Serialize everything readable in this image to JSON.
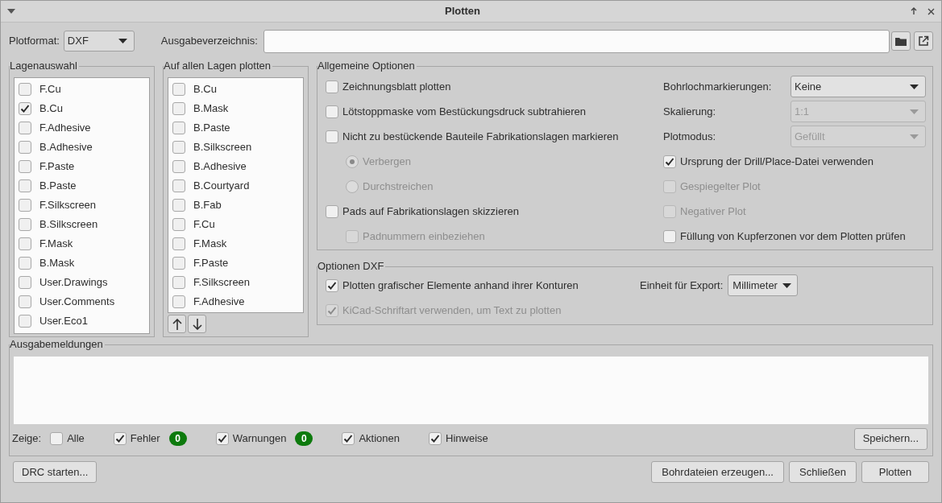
{
  "window": {
    "title": "Plotten"
  },
  "plot_format": {
    "label": "Plotformat:",
    "value": "DXF"
  },
  "output_dir": {
    "label": "Ausgabeverzeichnis:"
  },
  "layer_selection": {
    "title": "Lagenauswahl",
    "items": [
      {
        "label": "F.Cu",
        "checked": false
      },
      {
        "label": "B.Cu",
        "checked": true
      },
      {
        "label": "F.Adhesive",
        "checked": false
      },
      {
        "label": "B.Adhesive",
        "checked": false
      },
      {
        "label": "F.Paste",
        "checked": false
      },
      {
        "label": "B.Paste",
        "checked": false
      },
      {
        "label": "F.Silkscreen",
        "checked": false
      },
      {
        "label": "B.Silkscreen",
        "checked": false
      },
      {
        "label": "F.Mask",
        "checked": false
      },
      {
        "label": "B.Mask",
        "checked": false
      },
      {
        "label": "User.Drawings",
        "checked": false
      },
      {
        "label": "User.Comments",
        "checked": false
      },
      {
        "label": "User.Eco1",
        "checked": false
      }
    ]
  },
  "plot_on_all_layers": {
    "title": "Auf allen Lagen plotten",
    "items": [
      {
        "label": "B.Cu",
        "checked": false
      },
      {
        "label": "B.Mask",
        "checked": false
      },
      {
        "label": "B.Paste",
        "checked": false
      },
      {
        "label": "B.Silkscreen",
        "checked": false
      },
      {
        "label": "B.Adhesive",
        "checked": false
      },
      {
        "label": "B.Courtyard",
        "checked": false
      },
      {
        "label": "B.Fab",
        "checked": false
      },
      {
        "label": "F.Cu",
        "checked": false
      },
      {
        "label": "F.Mask",
        "checked": false
      },
      {
        "label": "F.Paste",
        "checked": false
      },
      {
        "label": "F.Silkscreen",
        "checked": false
      },
      {
        "label": "F.Adhesive",
        "checked": false
      }
    ]
  },
  "general_options": {
    "title": "Allgemeine Optionen",
    "left": [
      {
        "kind": "checkbox",
        "label": "Zeichnungsblatt plotten",
        "checked": false,
        "disabled": false
      },
      {
        "kind": "checkbox",
        "label": "Lötstoppmaske vom Bestückungsdruck subtrahieren",
        "checked": false,
        "disabled": false
      },
      {
        "kind": "checkbox",
        "label": "Nicht zu bestückende Bauteile Fabrikationslagen markieren",
        "checked": false,
        "disabled": false,
        "children": [
          {
            "kind": "radio",
            "label": "Verbergen",
            "selected": true,
            "disabled": true
          },
          {
            "kind": "radio",
            "label": "Durchstreichen",
            "selected": false,
            "disabled": true
          }
        ]
      },
      {
        "kind": "checkbox",
        "label": "Pads auf Fabrikationslagen skizzieren",
        "checked": false,
        "disabled": false,
        "children": [
          {
            "kind": "checkbox",
            "label": "Padnummern einbeziehen",
            "checked": false,
            "disabled": true
          }
        ]
      }
    ],
    "right": [
      {
        "kind": "select",
        "label": "Bohrlochmarkierungen:",
        "value": "Keine",
        "disabled": false
      },
      {
        "kind": "select",
        "label": "Skalierung:",
        "value": "1:1",
        "disabled": true
      },
      {
        "kind": "select",
        "label": "Plotmodus:",
        "value": "Gefüllt",
        "disabled": true
      },
      {
        "kind": "checkbox",
        "label": "Ursprung der Drill/Place-Datei verwenden",
        "checked": true,
        "disabled": false
      },
      {
        "kind": "checkbox",
        "label": "Gespiegelter Plot",
        "checked": false,
        "disabled": true
      },
      {
        "kind": "checkbox",
        "label": "Negativer Plot",
        "checked": false,
        "disabled": true
      },
      {
        "kind": "checkbox",
        "label": "Füllung von Kupferzonen vor dem Plotten prüfen",
        "checked": false,
        "disabled": false
      }
    ]
  },
  "dxf_options": {
    "title": "Optionen DXF",
    "checkboxes": [
      {
        "label": "Plotten grafischer Elemente anhand ihrer Konturen",
        "checked": true,
        "disabled": false
      },
      {
        "label": "KiCad-Schriftart verwenden, um Text zu plotten",
        "checked": true,
        "disabled": true
      }
    ],
    "unit": {
      "label": "Einheit für Export:",
      "value": "Millimeter"
    }
  },
  "messages": {
    "title": "Ausgabemeldungen",
    "show_label": "Zeige:",
    "filters": [
      {
        "label": "Alle",
        "checked": false
      },
      {
        "label": "Fehler",
        "checked": true,
        "count": "0"
      },
      {
        "label": "Warnungen",
        "checked": true,
        "count": "0"
      },
      {
        "label": "Aktionen",
        "checked": true
      },
      {
        "label": "Hinweise",
        "checked": true
      }
    ],
    "save_button": "Speichern..."
  },
  "buttons": {
    "left": "DRC starten...",
    "right": [
      "Bohrdateien erzeugen...",
      "Schließen",
      "Plotten"
    ]
  }
}
